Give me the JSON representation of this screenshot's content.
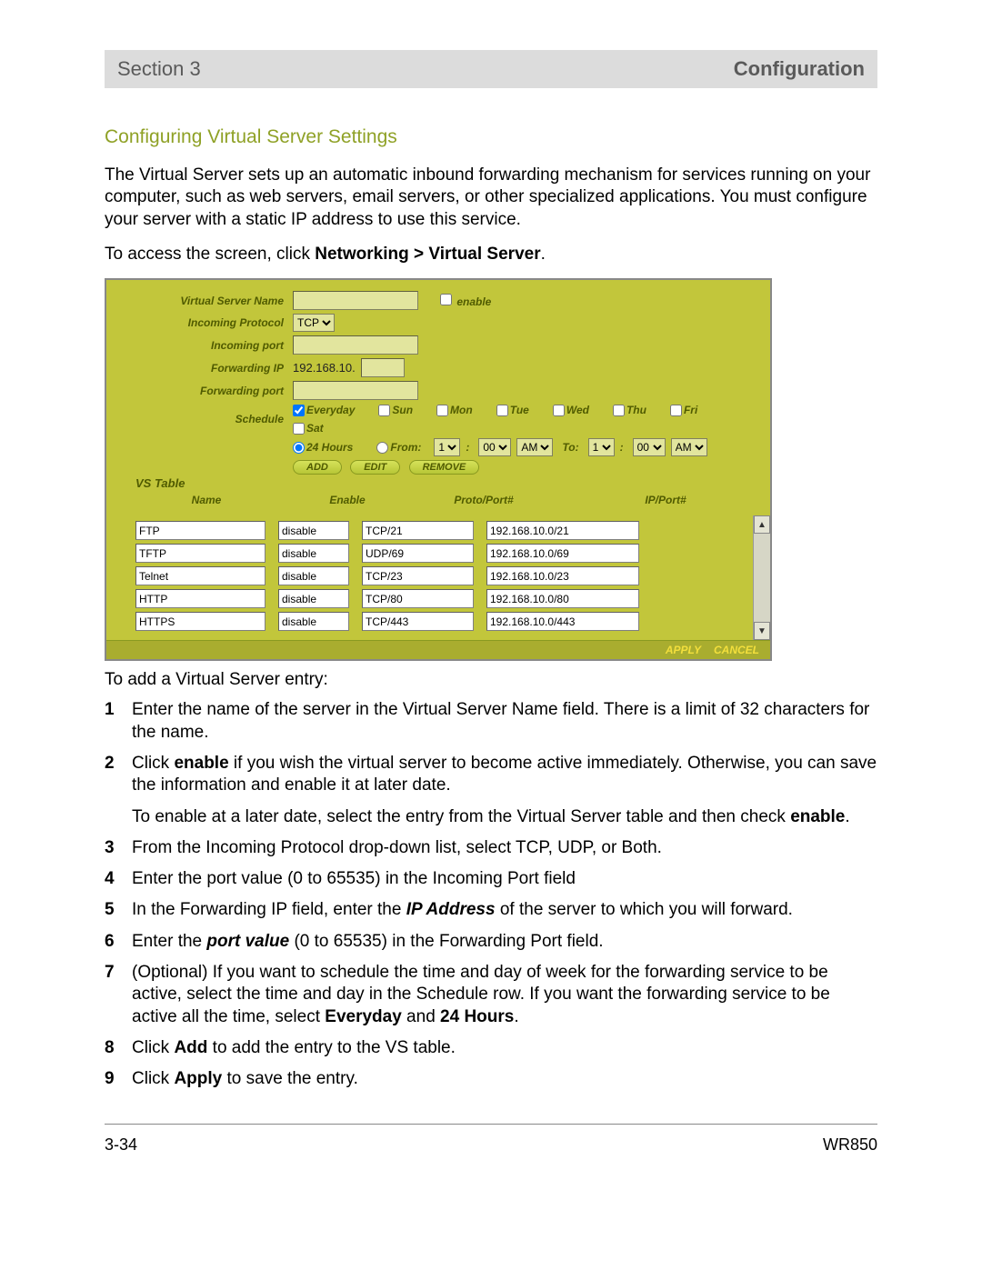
{
  "header": {
    "left": "Section 3",
    "right": "Configuration"
  },
  "subheading": "Configuring Virtual Server Settings",
  "intro": "The Virtual Server sets up an automatic inbound forwarding mechanism for services running on your computer, such as web servers, email servers, or other specialized applications. You must configure your server with a static IP address to use this service.",
  "access_pre": "To access the screen, click ",
  "access_bold": "Networking > Virtual Server",
  "access_post": ".",
  "form": {
    "labels": {
      "vsname": "Virtual Server Name",
      "enable": "enable",
      "protocol": "Incoming Protocol",
      "inport": "Incoming port",
      "fwdip": "Forwarding IP",
      "fwdport": "Forwarding port",
      "schedule": "Schedule",
      "vstable": "VS Table"
    },
    "protocol_value": "TCP",
    "ip_prefix": "192.168.10.",
    "days": {
      "everyday": "Everyday",
      "sun": "Sun",
      "mon": "Mon",
      "tue": "Tue",
      "wed": "Wed",
      "thu": "Thu",
      "fri": "Fri",
      "sat": "Sat"
    },
    "time": {
      "always": "24 Hours",
      "from": "From:",
      "to": "To:",
      "h1": "1",
      "m1": "00",
      "ap1": "AM",
      "h2": "1",
      "m2": "00",
      "ap2": "AM"
    },
    "buttons": {
      "add": "ADD",
      "edit": "EDIT",
      "remove": "REMOVE"
    },
    "headers": {
      "name": "Name",
      "enable": "Enable",
      "proto": "Proto/Port#",
      "ipport": "IP/Port#"
    },
    "rows": [
      {
        "name": "FTP",
        "enable": "disable",
        "proto": "TCP/21",
        "ip": "192.168.10.0/21"
      },
      {
        "name": "TFTP",
        "enable": "disable",
        "proto": "UDP/69",
        "ip": "192.168.10.0/69"
      },
      {
        "name": "Telnet",
        "enable": "disable",
        "proto": "TCP/23",
        "ip": "192.168.10.0/23"
      },
      {
        "name": "HTTP",
        "enable": "disable",
        "proto": "TCP/80",
        "ip": "192.168.10.0/80"
      },
      {
        "name": "HTTPS",
        "enable": "disable",
        "proto": "TCP/443",
        "ip": "192.168.10.0/443"
      }
    ],
    "apply": "APPLY",
    "cancel": "CANCEL"
  },
  "caption": "To add a Virtual Server entry:",
  "steps": {
    "s1": "Enter the name of the server in the Virtual Server Name field. There is a limit of 32 characters for the name.",
    "s2a": "Click ",
    "s2b": "enable",
    "s2c": " if you wish the virtual server to become active immediately. Otherwise, you can save the information and enable it at later date.",
    "s2sub_a": "To enable at a later date, select the entry from the Virtual Server table and then check ",
    "s2sub_b": "enable",
    "s2sub_c": ".",
    "s3": "From the Incoming Protocol drop-down list, select TCP, UDP, or Both.",
    "s4": "Enter the port value (0 to 65535) in the Incoming Port field",
    "s5a": "In the Forwarding IP field, enter the ",
    "s5b": "IP Address",
    "s5c": " of the server to which you will forward.",
    "s6a": "Enter the ",
    "s6b": "port value",
    "s6c": " (0 to 65535) in the Forwarding Port field.",
    "s7a": "(Optional) If you want to schedule the time and day of week for the forwarding service to be active, select the time and day in the Schedule row. If you want the forwarding service to be active all the time, select ",
    "s7b": "Everyday",
    "s7c": " and ",
    "s7d": "24 Hours",
    "s7e": ".",
    "s8a": "Click ",
    "s8b": "Add",
    "s8c": " to add the entry to the VS table.",
    "s9a": "Click ",
    "s9b": "Apply",
    "s9c": " to save the entry."
  },
  "footer": {
    "left": "3-34",
    "right": "WR850"
  }
}
